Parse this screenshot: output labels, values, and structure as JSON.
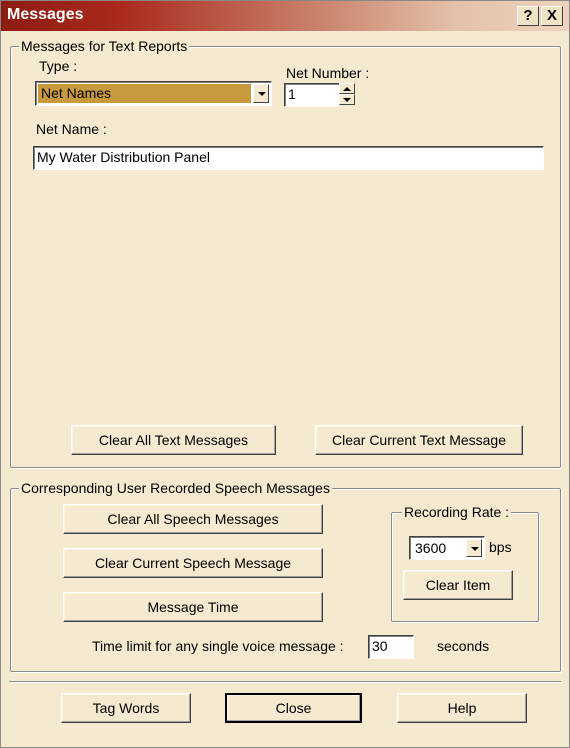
{
  "window": {
    "title": "Messages",
    "help_glyph": "?",
    "close_glyph": "X"
  },
  "text_reports": {
    "legend": "Messages for Text Reports",
    "type_label": "Type :",
    "type_value": "Net Names",
    "net_number_label": "Net Number :",
    "net_number_value": "1",
    "net_name_label": "Net Name :",
    "net_name_value": "My Water Distribution Panel",
    "clear_all_label": "Clear All Text Messages",
    "clear_current_label": "Clear Current Text Message"
  },
  "speech": {
    "legend": "Corresponding User Recorded Speech Messages",
    "clear_all_label": "Clear All Speech Messages",
    "clear_current_label": "Clear Current Speech Message",
    "message_time_label": "Message Time",
    "recording_rate_legend": "Recording Rate :",
    "rate_value": "3600",
    "rate_unit": "bps",
    "clear_item_label": "Clear Item",
    "time_limit_label": "Time limit for any single voice message :",
    "time_limit_value": "30",
    "time_limit_unit": "seconds"
  },
  "footer": {
    "tag_words_label": "Tag Words",
    "close_label": "Close",
    "help_label": "Help"
  }
}
